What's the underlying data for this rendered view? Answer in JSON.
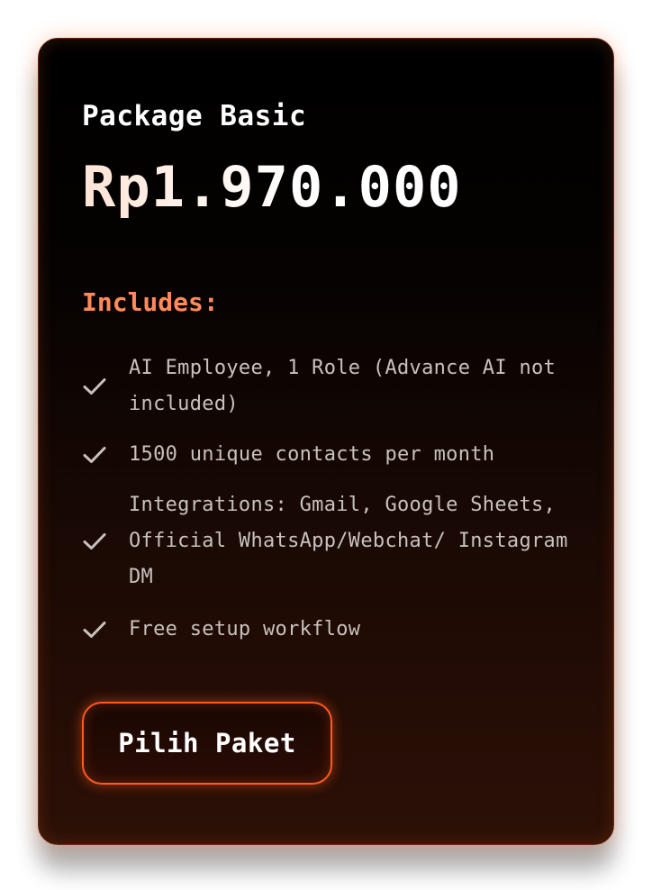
{
  "card": {
    "package_name": "Package Basic",
    "price": "Rp1.970.000",
    "includes_title": "Includes:",
    "features": [
      {
        "icon": "check-icon",
        "text": "AI Employee, 1 Role (Advance AI not included)"
      },
      {
        "icon": "check-icon",
        "text": "1500 unique contacts per month"
      },
      {
        "icon": "check-icon",
        "text": "Integrations: Gmail, Google Sheets, Official WhatsApp/Webchat/ Instagram DM"
      },
      {
        "icon": "check-icon",
        "text": "Free setup workflow"
      }
    ],
    "cta_label": "Pilih Paket"
  },
  "colors": {
    "accent": "#ff5a1f",
    "includes_title": "#ff8a5c",
    "card_background": "#000000",
    "feature_text": "#c8c1bc"
  }
}
